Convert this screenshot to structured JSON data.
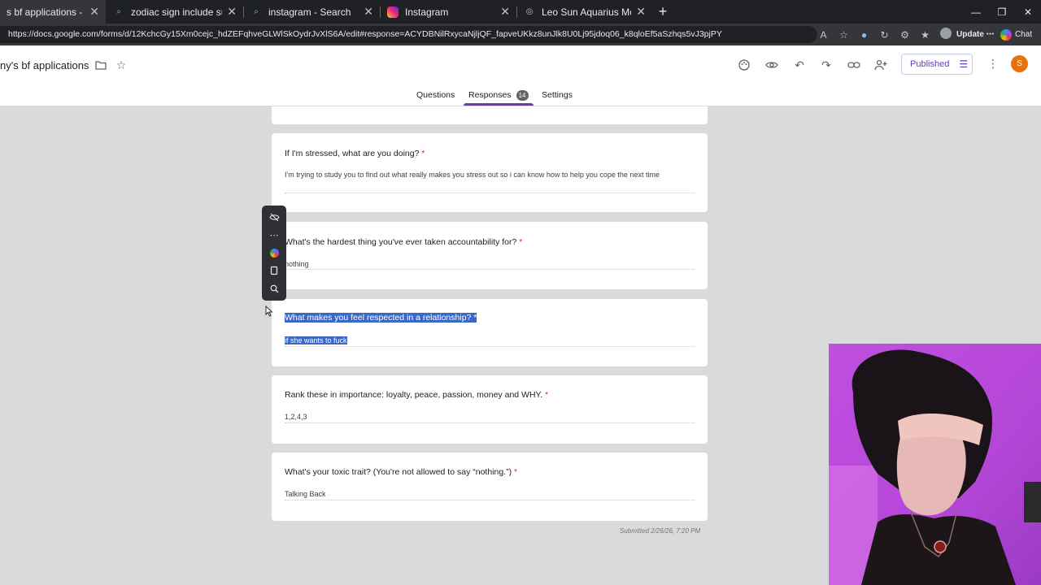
{
  "browser": {
    "tabs": [
      {
        "title": "s bf applications - Google Form",
        "active": true
      },
      {
        "title": "zodiac sign include sun, moon, AN",
        "active": false
      },
      {
        "title": "instagram - Search",
        "active": false
      },
      {
        "title": "Instagram",
        "active": false
      },
      {
        "title": "Leo Sun Aquarius Moon",
        "active": false
      }
    ],
    "url": "https://docs.google.com/forms/d/12KchcGy15Xm0cejc_hdZEFqhveGLWlSkOydrJvXlS6A/edit#response=ACYDBNilRxycaNjljQF_fapveUKkz8unJlk8U0Lj95jdoq06_k8qloEf5aSzhqs5vJ3pjPY",
    "update_label": "Update",
    "chat_label": "Chat"
  },
  "form": {
    "title": "ny's bf applications",
    "published_label": "Published",
    "user_initial": "S",
    "tabs": {
      "questions": "Questions",
      "responses": "Responses",
      "responses_count": "14",
      "settings": "Settings"
    }
  },
  "questions": [
    {
      "title": "If I'm stressed, what are you doing?",
      "answer": "I'm trying to study you to find out what really makes you stress out so i can know how to help you cope the next time"
    },
    {
      "title": "What's the hardest thing you've ever taken accountability for?",
      "answer": "nothing"
    },
    {
      "title": "What makes you feel respected in a relationship?",
      "answer": "if she wants to fuck",
      "selected": true
    },
    {
      "title": "Rank these in importance: loyalty, peace, passion, money and WHY.",
      "answer": "1,2,4,3"
    },
    {
      "title": "What's your toxic trait? (You're not allowed to say “nothing.”)",
      "answer": "Talking Back"
    }
  ],
  "required_mark": "*",
  "submitted": "Submitted 2/26/26, 7:20 PM",
  "toolbar_icons": [
    "eye-off-icon",
    "more-horizontal-icon",
    "copilot-icon",
    "copy-icon",
    "search-icon"
  ],
  "colors": {
    "accent": "#673ab7",
    "selection": "#3a68c9",
    "required": "#d93025"
  }
}
